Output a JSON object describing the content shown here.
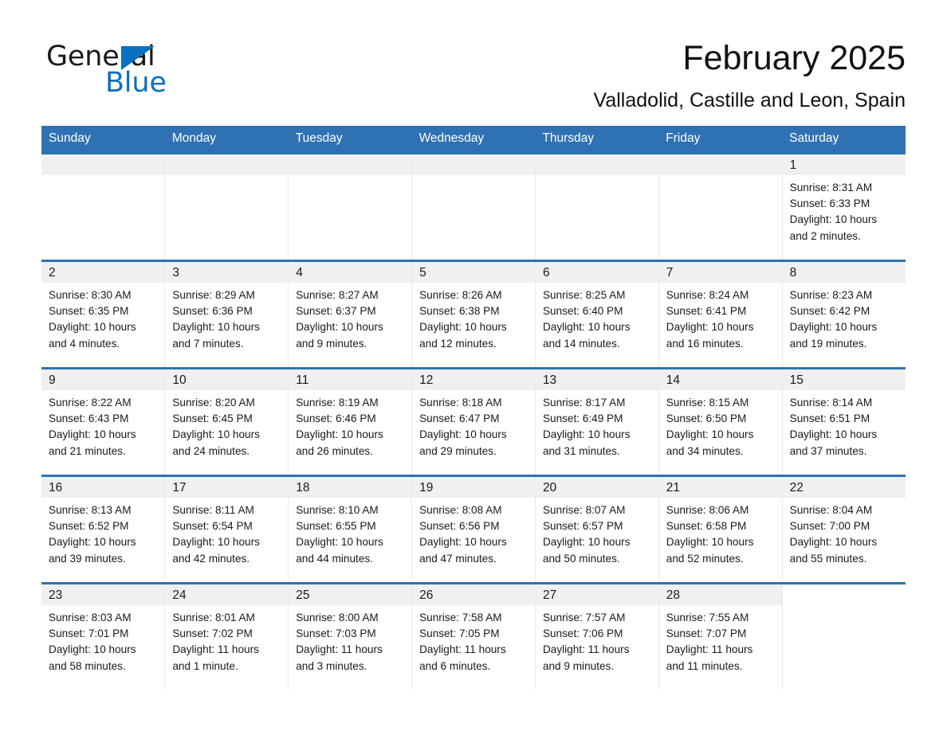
{
  "brand": {
    "line1": "General",
    "line2": "Blue",
    "flag_color": "#0a70bf"
  },
  "header": {
    "month_title": "February 2025",
    "location": "Valladolid, Castille and Leon, Spain"
  },
  "theme": {
    "header_blue": "#2f72b4",
    "band_gray": "#f0f0f0",
    "grid_line": "#e9e9e9"
  },
  "weekdays": [
    "Sunday",
    "Monday",
    "Tuesday",
    "Wednesday",
    "Thursday",
    "Friday",
    "Saturday"
  ],
  "weeks": [
    [
      {
        "day": "",
        "sunrise": "",
        "sunset": "",
        "daylight1": "",
        "daylight2": "",
        "empty": true,
        "leading": true
      },
      {
        "day": "",
        "sunrise": "",
        "sunset": "",
        "daylight1": "",
        "daylight2": "",
        "empty": true,
        "leading": true
      },
      {
        "day": "",
        "sunrise": "",
        "sunset": "",
        "daylight1": "",
        "daylight2": "",
        "empty": true,
        "leading": true
      },
      {
        "day": "",
        "sunrise": "",
        "sunset": "",
        "daylight1": "",
        "daylight2": "",
        "empty": true,
        "leading": true
      },
      {
        "day": "",
        "sunrise": "",
        "sunset": "",
        "daylight1": "",
        "daylight2": "",
        "empty": true,
        "leading": true
      },
      {
        "day": "",
        "sunrise": "",
        "sunset": "",
        "daylight1": "",
        "daylight2": "",
        "empty": true,
        "leading": true
      },
      {
        "day": "1",
        "sunrise": "Sunrise: 8:31 AM",
        "sunset": "Sunset: 6:33 PM",
        "daylight1": "Daylight: 10 hours",
        "daylight2": "and 2 minutes."
      }
    ],
    [
      {
        "day": "2",
        "sunrise": "Sunrise: 8:30 AM",
        "sunset": "Sunset: 6:35 PM",
        "daylight1": "Daylight: 10 hours",
        "daylight2": "and 4 minutes."
      },
      {
        "day": "3",
        "sunrise": "Sunrise: 8:29 AM",
        "sunset": "Sunset: 6:36 PM",
        "daylight1": "Daylight: 10 hours",
        "daylight2": "and 7 minutes."
      },
      {
        "day": "4",
        "sunrise": "Sunrise: 8:27 AM",
        "sunset": "Sunset: 6:37 PM",
        "daylight1": "Daylight: 10 hours",
        "daylight2": "and 9 minutes."
      },
      {
        "day": "5",
        "sunrise": "Sunrise: 8:26 AM",
        "sunset": "Sunset: 6:38 PM",
        "daylight1": "Daylight: 10 hours",
        "daylight2": "and 12 minutes."
      },
      {
        "day": "6",
        "sunrise": "Sunrise: 8:25 AM",
        "sunset": "Sunset: 6:40 PM",
        "daylight1": "Daylight: 10 hours",
        "daylight2": "and 14 minutes."
      },
      {
        "day": "7",
        "sunrise": "Sunrise: 8:24 AM",
        "sunset": "Sunset: 6:41 PM",
        "daylight1": "Daylight: 10 hours",
        "daylight2": "and 16 minutes."
      },
      {
        "day": "8",
        "sunrise": "Sunrise: 8:23 AM",
        "sunset": "Sunset: 6:42 PM",
        "daylight1": "Daylight: 10 hours",
        "daylight2": "and 19 minutes."
      }
    ],
    [
      {
        "day": "9",
        "sunrise": "Sunrise: 8:22 AM",
        "sunset": "Sunset: 6:43 PM",
        "daylight1": "Daylight: 10 hours",
        "daylight2": "and 21 minutes."
      },
      {
        "day": "10",
        "sunrise": "Sunrise: 8:20 AM",
        "sunset": "Sunset: 6:45 PM",
        "daylight1": "Daylight: 10 hours",
        "daylight2": "and 24 minutes."
      },
      {
        "day": "11",
        "sunrise": "Sunrise: 8:19 AM",
        "sunset": "Sunset: 6:46 PM",
        "daylight1": "Daylight: 10 hours",
        "daylight2": "and 26 minutes."
      },
      {
        "day": "12",
        "sunrise": "Sunrise: 8:18 AM",
        "sunset": "Sunset: 6:47 PM",
        "daylight1": "Daylight: 10 hours",
        "daylight2": "and 29 minutes."
      },
      {
        "day": "13",
        "sunrise": "Sunrise: 8:17 AM",
        "sunset": "Sunset: 6:49 PM",
        "daylight1": "Daylight: 10 hours",
        "daylight2": "and 31 minutes."
      },
      {
        "day": "14",
        "sunrise": "Sunrise: 8:15 AM",
        "sunset": "Sunset: 6:50 PM",
        "daylight1": "Daylight: 10 hours",
        "daylight2": "and 34 minutes."
      },
      {
        "day": "15",
        "sunrise": "Sunrise: 8:14 AM",
        "sunset": "Sunset: 6:51 PM",
        "daylight1": "Daylight: 10 hours",
        "daylight2": "and 37 minutes."
      }
    ],
    [
      {
        "day": "16",
        "sunrise": "Sunrise: 8:13 AM",
        "sunset": "Sunset: 6:52 PM",
        "daylight1": "Daylight: 10 hours",
        "daylight2": "and 39 minutes."
      },
      {
        "day": "17",
        "sunrise": "Sunrise: 8:11 AM",
        "sunset": "Sunset: 6:54 PM",
        "daylight1": "Daylight: 10 hours",
        "daylight2": "and 42 minutes."
      },
      {
        "day": "18",
        "sunrise": "Sunrise: 8:10 AM",
        "sunset": "Sunset: 6:55 PM",
        "daylight1": "Daylight: 10 hours",
        "daylight2": "and 44 minutes."
      },
      {
        "day": "19",
        "sunrise": "Sunrise: 8:08 AM",
        "sunset": "Sunset: 6:56 PM",
        "daylight1": "Daylight: 10 hours",
        "daylight2": "and 47 minutes."
      },
      {
        "day": "20",
        "sunrise": "Sunrise: 8:07 AM",
        "sunset": "Sunset: 6:57 PM",
        "daylight1": "Daylight: 10 hours",
        "daylight2": "and 50 minutes."
      },
      {
        "day": "21",
        "sunrise": "Sunrise: 8:06 AM",
        "sunset": "Sunset: 6:58 PM",
        "daylight1": "Daylight: 10 hours",
        "daylight2": "and 52 minutes."
      },
      {
        "day": "22",
        "sunrise": "Sunrise: 8:04 AM",
        "sunset": "Sunset: 7:00 PM",
        "daylight1": "Daylight: 10 hours",
        "daylight2": "and 55 minutes."
      }
    ],
    [
      {
        "day": "23",
        "sunrise": "Sunrise: 8:03 AM",
        "sunset": "Sunset: 7:01 PM",
        "daylight1": "Daylight: 10 hours",
        "daylight2": "and 58 minutes."
      },
      {
        "day": "24",
        "sunrise": "Sunrise: 8:01 AM",
        "sunset": "Sunset: 7:02 PM",
        "daylight1": "Daylight: 11 hours",
        "daylight2": "and 1 minute."
      },
      {
        "day": "25",
        "sunrise": "Sunrise: 8:00 AM",
        "sunset": "Sunset: 7:03 PM",
        "daylight1": "Daylight: 11 hours",
        "daylight2": "and 3 minutes."
      },
      {
        "day": "26",
        "sunrise": "Sunrise: 7:58 AM",
        "sunset": "Sunset: 7:05 PM",
        "daylight1": "Daylight: 11 hours",
        "daylight2": "and 6 minutes."
      },
      {
        "day": "27",
        "sunrise": "Sunrise: 7:57 AM",
        "sunset": "Sunset: 7:06 PM",
        "daylight1": "Daylight: 11 hours",
        "daylight2": "and 9 minutes."
      },
      {
        "day": "28",
        "sunrise": "Sunrise: 7:55 AM",
        "sunset": "Sunset: 7:07 PM",
        "daylight1": "Daylight: 11 hours",
        "daylight2": "and 11 minutes."
      },
      {
        "day": "",
        "sunrise": "",
        "sunset": "",
        "daylight1": "",
        "daylight2": "",
        "empty": true,
        "trailing": true
      }
    ]
  ]
}
